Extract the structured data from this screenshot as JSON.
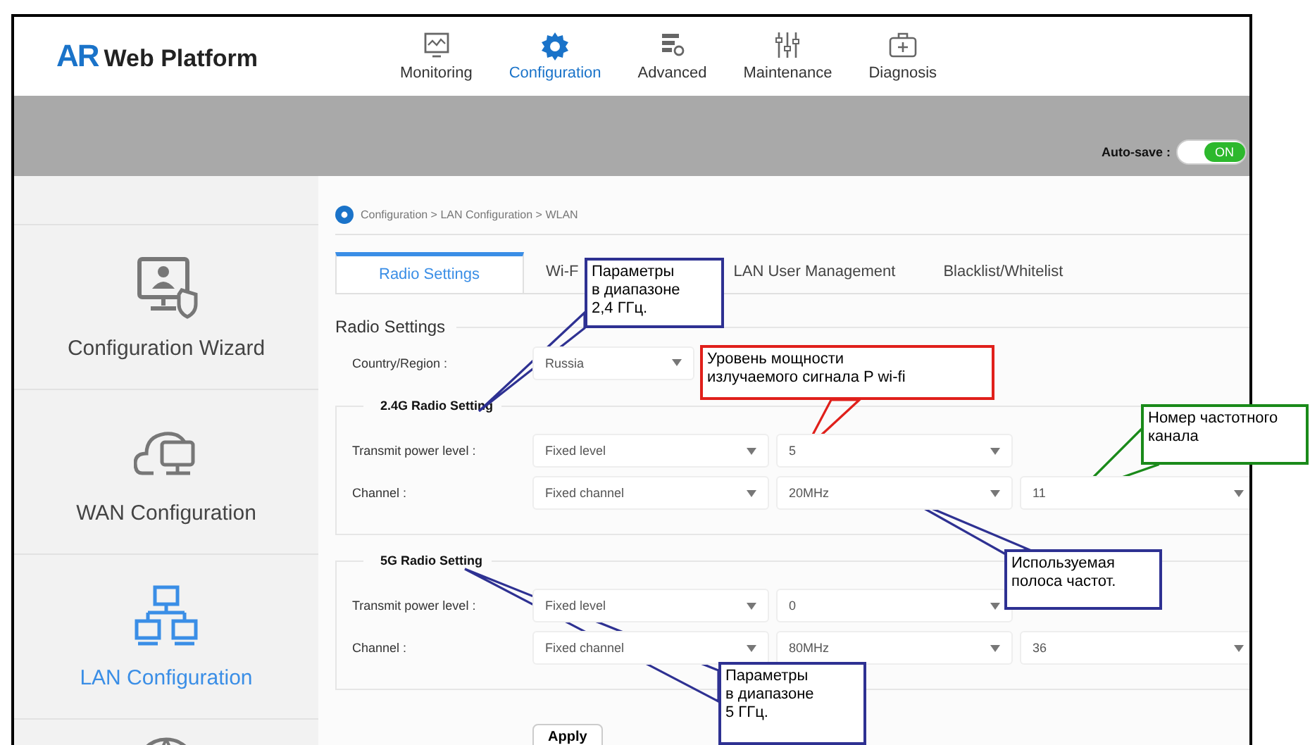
{
  "header": {
    "logo_mark": "AR",
    "logo_text": "Web Platform",
    "nav": [
      {
        "label": "Monitoring",
        "selected": false
      },
      {
        "label": "Configuration",
        "selected": true
      },
      {
        "label": "Advanced",
        "selected": false
      },
      {
        "label": "Maintenance",
        "selected": false
      },
      {
        "label": "Diagnosis",
        "selected": false
      }
    ]
  },
  "toolbar": {
    "label": "Auto-save :",
    "toggle": {
      "on": true,
      "text": "ON"
    }
  },
  "sidebar": {
    "items": [
      {
        "label": "Configuration Wizard",
        "selected": false
      },
      {
        "label": "WAN Configuration",
        "selected": false
      },
      {
        "label": "LAN Configuration",
        "selected": true
      }
    ]
  },
  "content": {
    "breadcrumb": "Configuration > LAN Configuration > WLAN",
    "tabs": [
      {
        "label": "Radio Settings",
        "selected": true
      },
      {
        "label": "Wi-F",
        "selected": false
      },
      {
        "label": "LAN User Management",
        "selected": false
      },
      {
        "label": "Blacklist/Whitelist",
        "selected": false
      }
    ],
    "section_title": "Radio Settings",
    "country": {
      "label": "Country/Region :",
      "value": "Russia"
    },
    "groups": [
      {
        "title": "2.4G Radio Setting",
        "rows": [
          {
            "label": "Transmit power level :",
            "selects": [
              "Fixed level",
              "5"
            ]
          },
          {
            "label": "Channel :",
            "selects": [
              "Fixed channel",
              "20MHz",
              "11"
            ]
          }
        ]
      },
      {
        "title": "5G Radio Setting",
        "rows": [
          {
            "label": "Transmit power level :",
            "selects": [
              "Fixed level",
              "0"
            ]
          },
          {
            "label": "Channel :",
            "selects": [
              "Fixed channel",
              "80MHz",
              "36"
            ]
          }
        ]
      }
    ],
    "apply": "Apply"
  },
  "annotations": [
    {
      "lines": [
        "Параметры",
        "в диапазоне",
        "2,4 ГГц."
      ],
      "color": "#2e3192"
    },
    {
      "lines": [
        "Уровень  мощности",
        "излучаемого сигнала P wi-fi"
      ],
      "color": "#e0201b"
    },
    {
      "lines": [
        "Номер частотного",
        "канала"
      ],
      "color": "#1a8a1a"
    },
    {
      "lines": [
        "Используемая",
        "полоса частот."
      ],
      "color": "#2e3192"
    },
    {
      "lines": [
        "Параметры",
        "в диапазоне",
        "5 ГГц."
      ],
      "color": "#2e3192"
    }
  ]
}
